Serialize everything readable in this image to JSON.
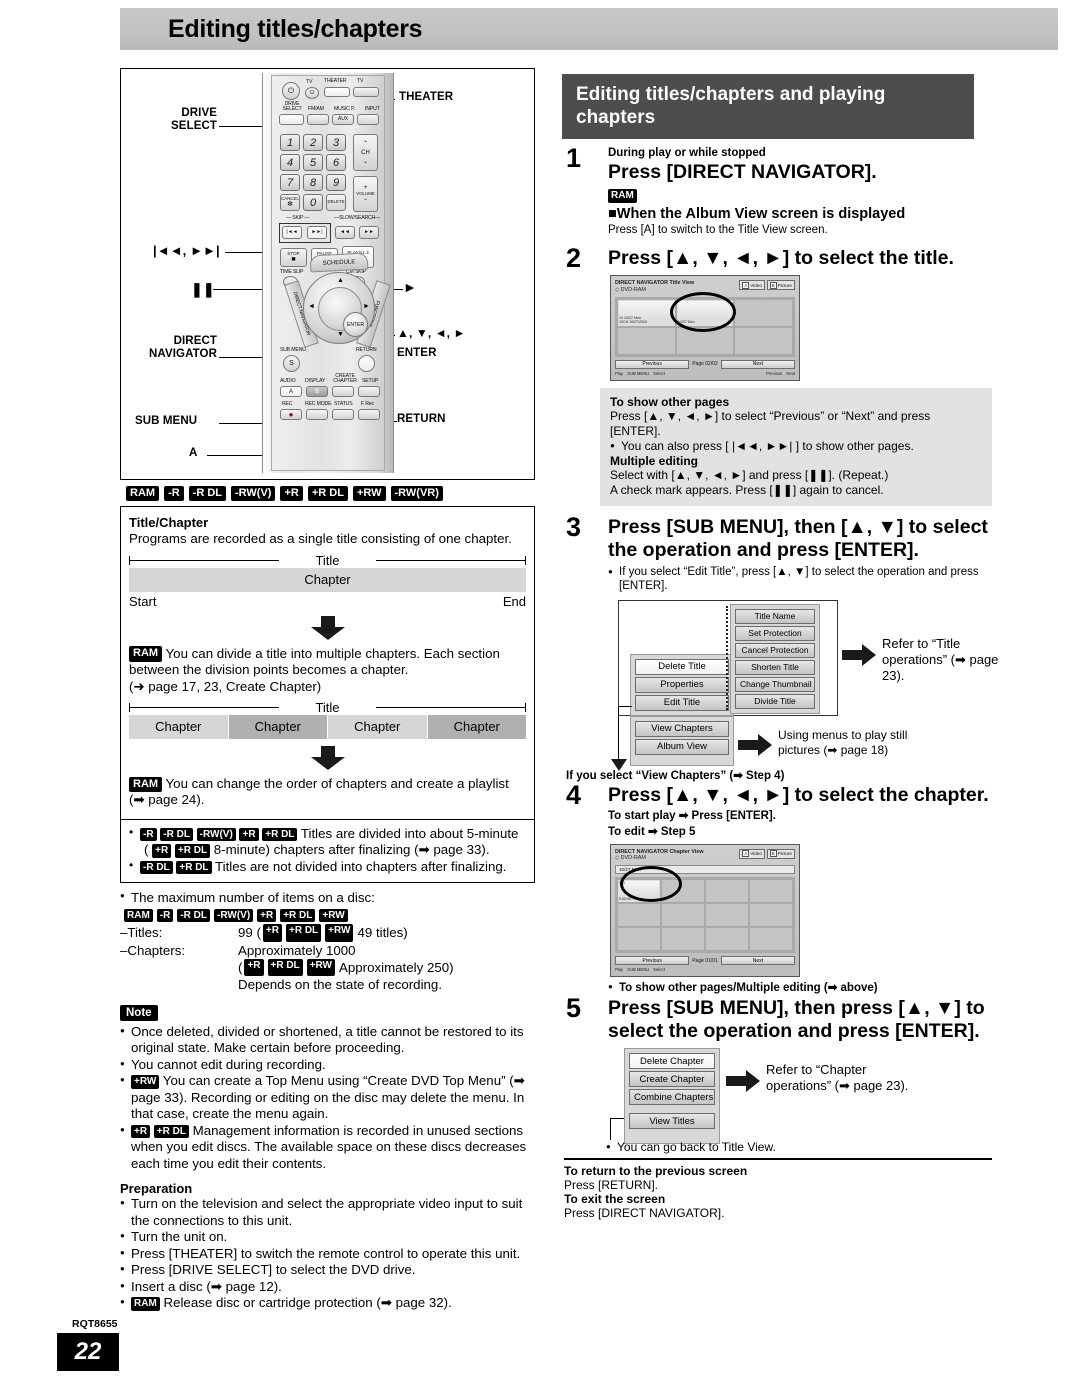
{
  "page": {
    "header_title": "Editing titles/chapters",
    "doc_code": "RQT8655",
    "page_number": "22"
  },
  "remote": {
    "callouts": {
      "drive_select": "DRIVE\nSELECT",
      "theater": "THEATER",
      "skip": "◄◄, ►►◄",
      "pause": "❚❚",
      "play": "►",
      "direct_navigator": "DIRECT\nNAVIGATOR",
      "cursor": "▲, ▼, ◄, ►",
      "enter": "ENTER",
      "sub_menu": "SUB MENU",
      "return": "RETURN",
      "a_button": "A"
    },
    "buttons": {
      "tv": "TV",
      "theater_sw": "THEATER",
      "tv_sw": "TV",
      "drive_select": "DRIVE SELECT",
      "fm_am": "FM/AM",
      "music_p": "MUSIC P.",
      "aux": "AUX",
      "input": "INPUT",
      "numbers": [
        "1",
        "2",
        "3",
        "4",
        "5",
        "6",
        "7",
        "8",
        "9",
        "0"
      ],
      "cancel": "CANCEL",
      "cancel_sym": "✻",
      "delete": "DELETE",
      "ch": "CH",
      "volume": "VOLUME",
      "skip_group": "SKIP",
      "slow_search": "SLOW/SEARCH",
      "skip_back": "◄◄",
      "skip_fwd": "►►◄",
      "search_back": "◄◄",
      "search_fwd": "►►",
      "stop": "STOP",
      "pause": "PAUSE",
      "play": "PLAY/x1.3",
      "time_slip": "TIME SLIP",
      "cm_skip": "CM SKIP",
      "schedule": "SCHEDULE",
      "direct_navigator": "DIRECT NAVIGATOR",
      "functions": "FUNCTIONS",
      "enter": "ENTER",
      "sub_menu": "SUB MENU",
      "sub_menu_sym": "S",
      "return": "RETURN",
      "audio": "AUDIO",
      "display": "DISPLAY",
      "create_chapter": "CREATE CHAPTER",
      "setup": "SETUP",
      "a": "A",
      "b": "B",
      "rec": "REC",
      "rec_mode": "REC MODE",
      "status": "STATUS",
      "f_rec": "F Rec"
    }
  },
  "disc_badges": [
    "RAM",
    "-R",
    "-R DL",
    "-RW(V)",
    "+R",
    "+R DL",
    "+RW",
    "-RW(VR)"
  ],
  "title_chapter": {
    "heading": "Title/Chapter",
    "intro": "Programs are recorded as a single title consisting of one chapter.",
    "diagram1": {
      "title_label": "Title",
      "chapter_label": "Chapter",
      "start": "Start",
      "end": "End"
    },
    "divide_text_badge": "RAM",
    "divide_text": "You can divide a title into multiple chapters. Each section between the division points becomes a chapter.",
    "divide_ref": "(➜ page 17, 23, Create Chapter)",
    "diagram2": {
      "title_label": "Title",
      "chapters": [
        "Chapter",
        "Chapter",
        "Chapter",
        "Chapter"
      ]
    },
    "playlist_badge": "RAM",
    "playlist_text": "You can change the order of chapters and create a playlist",
    "playlist_ref": "(➡ page 24).",
    "finalize_bullet1_badges": [
      "-R",
      "-R DL",
      "-RW(V)",
      "+R",
      "+R DL"
    ],
    "finalize_bullet1_text": "Titles are divided into about 5-minute",
    "finalize_bullet1_badges2": [
      "+R",
      "+R DL"
    ],
    "finalize_bullet1_text2": "8-minute) chapters after finalizing (➡ page 33).",
    "finalize_bullet2_badges": [
      "-R DL",
      "+R DL"
    ],
    "finalize_bullet2_text": "Titles are not divided into chapters after finalizing.",
    "max_items_heading": "The maximum number of items on a disc:",
    "max_items_badges": [
      "RAM",
      "-R",
      "-R DL",
      "-RW(V)",
      "+R",
      "+R DL",
      "+RW"
    ],
    "titles_label": "–Titles:",
    "titles_value": "99 (",
    "titles_badges": [
      "+R",
      "+R DL",
      "+RW"
    ],
    "titles_value2": "49 titles)",
    "chapters_label": "–Chapters:",
    "chapters_value": "Approximately 1000",
    "chapters_paren_open": "(",
    "chapters_badges": [
      "+R",
      "+R DL",
      "+RW"
    ],
    "chapters_value2": "Approximately 250)",
    "chapters_value3": "Depends on the state of recording."
  },
  "note": {
    "tag": "Note",
    "items": [
      "Once deleted, divided or shortened, a title cannot be restored to its original state. Make certain before proceeding.",
      "You cannot edit during recording."
    ],
    "rw_badge": "+RW",
    "rw_text": "You can create a Top Menu using “Create DVD Top Menu” (➡ page 33). Recording or editing on the disc may delete the menu. In that case, create the menu again.",
    "plusr_badges": [
      "+R",
      "+R DL"
    ],
    "plusr_text": "Management information is recorded in unused sections when you edit discs. The available space on these discs decreases each time you edit their contents."
  },
  "preparation": {
    "heading": "Preparation",
    "items": [
      "Turn on the television and select the appropriate video input to suit the connections to this unit.",
      "Turn the unit on.",
      "Press [THEATER] to switch the remote control to operate this unit.",
      "Press [DRIVE SELECT] to select the DVD drive.",
      "Insert a disc (➡ page 12)."
    ],
    "last_badge": "RAM",
    "last_text": "Release disc or cartridge protection (➡ page 32)."
  },
  "right": {
    "section_title": "Editing titles/chapters and playing chapters",
    "step1": {
      "num": "1",
      "pre": "During play or while stopped",
      "title": "Press [DIRECT NAVIGATOR].",
      "badge": "RAM",
      "sub": "■When the Album View screen is displayed",
      "body": "Press [A] to switch to the Title View screen."
    },
    "step2": {
      "num": "2",
      "title": "Press [▲, ▼, ◄, ►] to select the title."
    },
    "title_view_screen": {
      "header": "DIRECT NAVIGATOR Title View",
      "subheader": "DVD-RAM",
      "tab_a_key": "A",
      "tab_a": "Video",
      "tab_b_key": "B",
      "tab_b": "Picture",
      "cell1_line1": "10  10/27 Mon",
      "cell1_line2": "10CH 10/27/2005",
      "cell2_line1": "10/27 Mon",
      "prev": "Previous",
      "page_label": "Page",
      "page_value": "02/02",
      "next": "Next",
      "foot_play": "Play",
      "foot_submenu": "SUB MENU",
      "foot_select": "Select",
      "foot_prev": "Previous",
      "foot_next": "Next"
    },
    "grey_box": {
      "h1": "To show other pages",
      "p1": "Press [▲, ▼, ◄, ►] to select “Previous” or “Next” and press [ENTER].",
      "p2": "You can also press [ |◄◄, ►►| ] to show other pages.",
      "h2": "Multiple editing",
      "p3": "Select with [▲, ▼, ◄, ►] and press [❚❚]. (Repeat.)",
      "p4": "A check mark appears. Press [❚❚] again to cancel."
    },
    "step3": {
      "num": "3",
      "title": "Press [SUB MENU], then [▲, ▼] to select the operation and press [ENTER].",
      "body": "If you select “Edit Title”, press [▲, ▼] to select the operation and press [ENTER]."
    },
    "title_menu": {
      "main": [
        "Delete Title",
        "Properties",
        "Edit Title"
      ],
      "sub": [
        "Title Name",
        "Set Protection",
        "Cancel Protection",
        "Shorten Title",
        "Change Thumbnail",
        "Divide Title"
      ],
      "lower": [
        "View Chapters",
        "Album View"
      ],
      "refer1": "Refer to “Title operations” (➡ page 23).",
      "refer2": "Using menus to play still pictures (➡ page 18)"
    },
    "step4_pre": "If you select “View Chapters” (➡ Step 4)",
    "step4": {
      "num": "4",
      "title": "Press [▲, ▼, ◄, ►] to select the chapter.",
      "body1": "To start play ➡ Press [ENTER].",
      "body2": "To edit ➡ Step 5"
    },
    "chapter_view_screen": {
      "header": "DIRECT NAVIGATOR Chapter View",
      "subheader": "DVD-RAM",
      "tab_a_key": "A",
      "tab_a": "Video",
      "tab_b_key": "B",
      "tab_b": "Picture",
      "bar_text": "10/27 Mon",
      "cell1_num": "001",
      "cell1_time": "0:00:00",
      "prev": "Previous",
      "page_label": "Page",
      "page_value": "01/01",
      "next": "Next",
      "foot_play": "Play",
      "foot_submenu": "SUB MENU",
      "foot_select": "Select"
    },
    "step4_after": "To show other pages/Multiple editing (➡ above)",
    "step5": {
      "num": "5",
      "title": "Press [SUB MENU], then press [▲, ▼] to select the operation and press [ENTER]."
    },
    "chapter_menu": {
      "items": [
        "Delete Chapter",
        "Create Chapter",
        "Combine Chapters",
        "View Titles"
      ],
      "refer": "Refer to “Chapter operations” (➡ page 23).",
      "back_note": "You can go back to Title View."
    },
    "tail": {
      "h1": "To return to the previous screen",
      "p1": "Press [RETURN].",
      "h2": "To exit the screen",
      "p2": "Press [DIRECT NAVIGATOR]."
    }
  }
}
